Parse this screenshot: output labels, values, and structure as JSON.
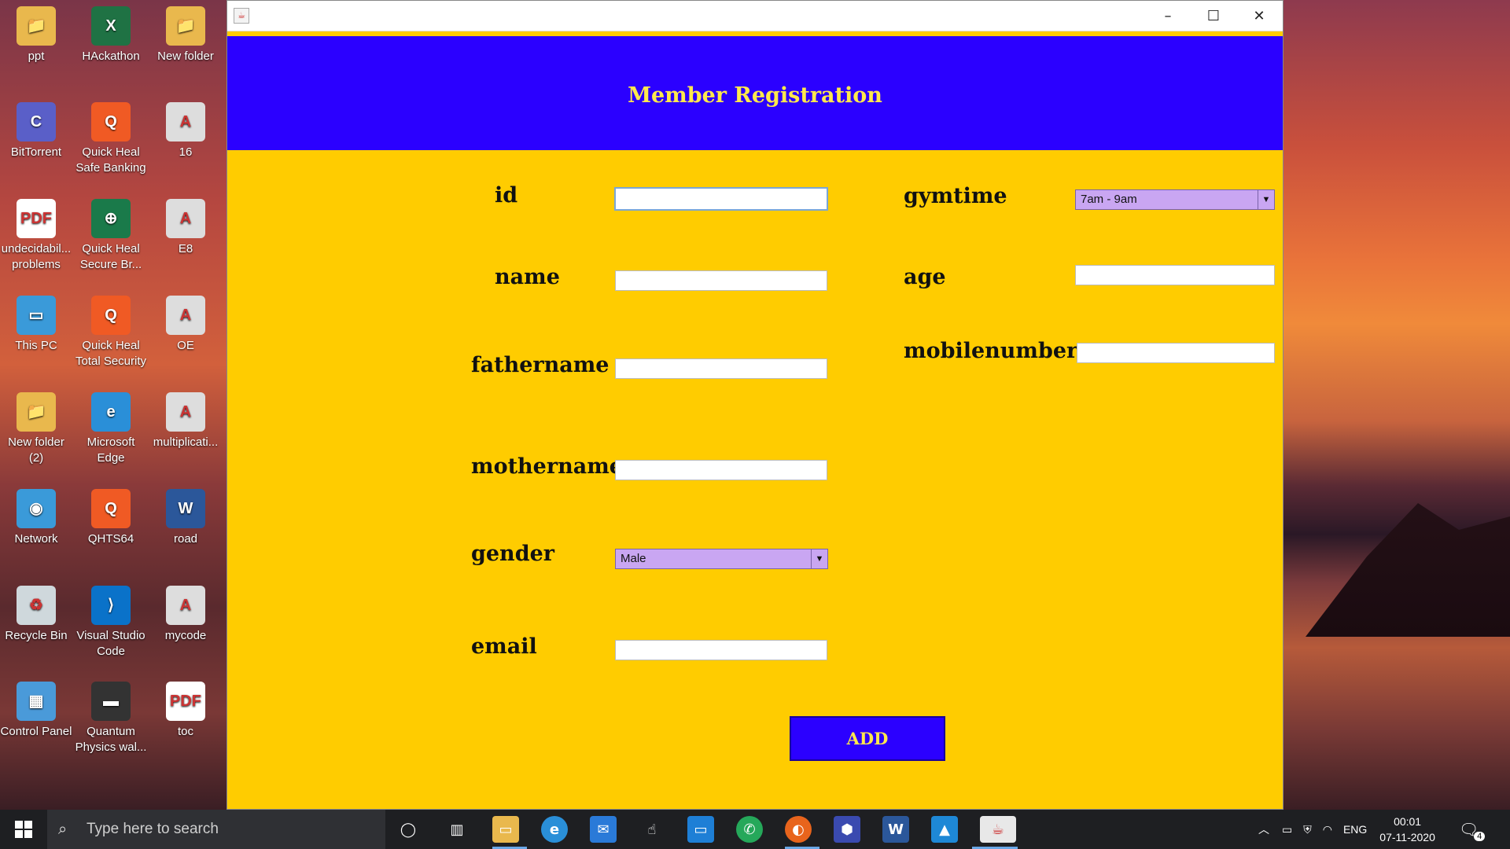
{
  "desktop": {
    "icons": [
      {
        "label": "ppt",
        "color": "#e9b84d",
        "glyph": "📁"
      },
      {
        "label": "HAckathon",
        "color": "#1f7244",
        "glyph": "X"
      },
      {
        "label": "New folder",
        "color": "#e9b84d",
        "glyph": "📁"
      },
      {
        "label": "BitTorrent",
        "color": "#5a5fc8",
        "glyph": "C"
      },
      {
        "label": "Quick Heal Safe Banking",
        "color": "#f05a24",
        "glyph": "Q"
      },
      {
        "label": "16",
        "color": "#dddddd",
        "glyph": "A"
      },
      {
        "label": "undecidabil... problems",
        "color": "#ffffff",
        "glyph": "PDF"
      },
      {
        "label": "Quick Heal Secure Br...",
        "color": "#1a7a4a",
        "glyph": "⊕"
      },
      {
        "label": "E8",
        "color": "#dddddd",
        "glyph": "A"
      },
      {
        "label": "This PC",
        "color": "#3a9ad9",
        "glyph": "▭"
      },
      {
        "label": "Quick Heal Total Security",
        "color": "#f05a24",
        "glyph": "Q"
      },
      {
        "label": "OE",
        "color": "#dddddd",
        "glyph": "A"
      },
      {
        "label": "New folder (2)",
        "color": "#e9b84d",
        "glyph": "📁"
      },
      {
        "label": "Microsoft Edge",
        "color": "#2a8fd8",
        "glyph": "e"
      },
      {
        "label": "multiplicati...",
        "color": "#dddddd",
        "glyph": "A"
      },
      {
        "label": "Network",
        "color": "#3a9ad9",
        "glyph": "◉"
      },
      {
        "label": "QHTS64",
        "color": "#f05a24",
        "glyph": "Q"
      },
      {
        "label": "road",
        "color": "#2b579a",
        "glyph": "W"
      },
      {
        "label": "Recycle Bin",
        "color": "#cfd8dc",
        "glyph": "♻"
      },
      {
        "label": "Visual Studio Code",
        "color": "#0a72c9",
        "glyph": "⟩"
      },
      {
        "label": "mycode",
        "color": "#dddddd",
        "glyph": "A"
      },
      {
        "label": "Control Panel",
        "color": "#4a9ad9",
        "glyph": "▦"
      },
      {
        "label": "Quantum Physics wal...",
        "color": "#333333",
        "glyph": "▬"
      },
      {
        "label": "toc",
        "color": "#ffffff",
        "glyph": "PDF"
      }
    ]
  },
  "window": {
    "app_icon": "java-icon",
    "controls": {
      "minimize": "–",
      "maximize": "☐",
      "close": "✕"
    },
    "header_title": "Member Registration",
    "colors": {
      "header_bg": "#2b00ff",
      "header_text": "#ffe84d",
      "body_bg": "#ffcc00",
      "select_bg": "#c9a6f2"
    },
    "form": {
      "id_label": "id",
      "id_value": "",
      "name_label": "name",
      "name_value": "",
      "fathername_label": "fathername",
      "fathername_value": "",
      "mothername_label": "mothername",
      "mothername_value": "",
      "gender_label": "gender",
      "gender_value": "Male",
      "email_label": "email",
      "email_value": "",
      "gymtime_label": "gymtime",
      "gymtime_value": "7am - 9am",
      "age_label": "age",
      "age_value": "",
      "mobilenumber_label": "mobilenumber",
      "mobilenumber_value": "",
      "add_button": "ADD"
    }
  },
  "taskbar": {
    "search_placeholder": "Type here to search",
    "apps": [
      "cortana-icon",
      "task-view-icon",
      "file-explorer-icon",
      "edge-icon",
      "mail-icon",
      "touch-icon",
      "window-icon",
      "whatsapp-icon",
      "firefox-icon",
      "cube-app-icon",
      "word-icon",
      "photos-icon",
      "java-icon"
    ],
    "tray": {
      "language": "ENG",
      "time": "00:01",
      "date": "07-11-2020",
      "notification_count": "4"
    }
  }
}
